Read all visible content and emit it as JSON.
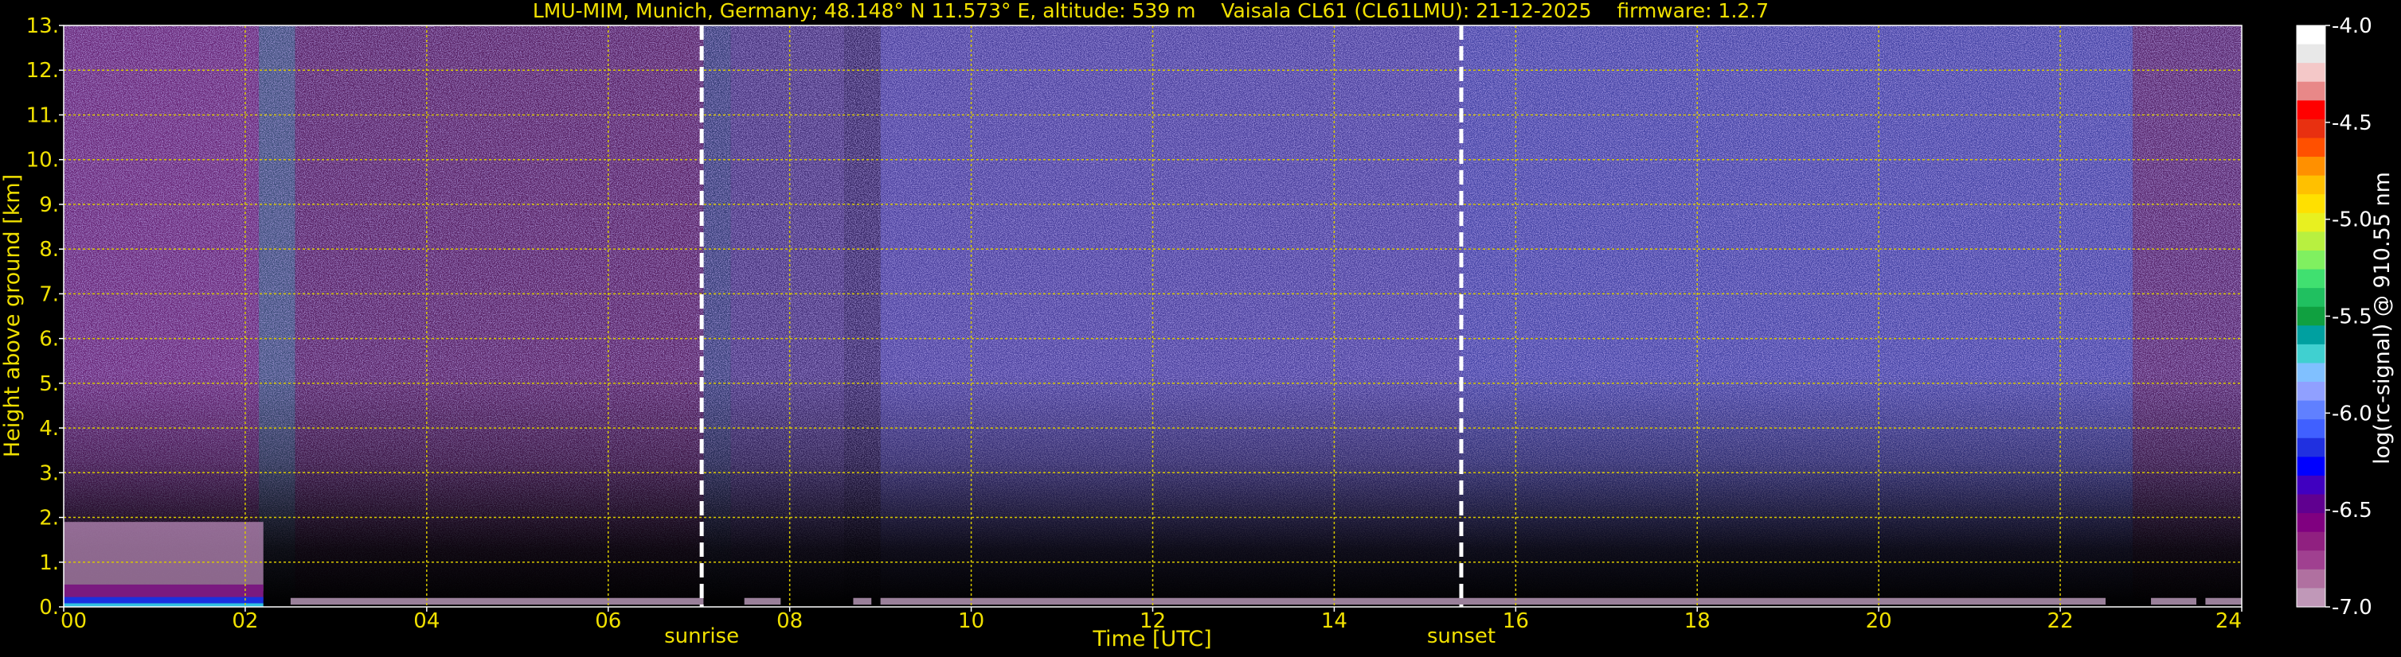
{
  "chart_data": {
    "type": "heatmap",
    "title": "LMU-MIM, Munich, Germany; 48.148° N 11.573° E, altitude: 539 m    Vaisala CL61 (CL61LMU): 21-12-2025    firmware: 1.2.7",
    "xlabel": "Time [UTC]",
    "ylabel": "Height above ground [km]",
    "xlim": [
      0,
      24
    ],
    "ylim": [
      0,
      13
    ],
    "x_ticks": [
      "00",
      "02",
      "04",
      "06",
      "08",
      "10",
      "12",
      "14",
      "16",
      "18",
      "20",
      "22",
      "24"
    ],
    "y_ticks": [
      "0.",
      "1.",
      "2.",
      "3.",
      "4.",
      "5.",
      "6.",
      "7.",
      "8.",
      "9.",
      "10.",
      "11.",
      "12.",
      "13."
    ],
    "grid": true,
    "vlines": [
      {
        "label": "sunrise",
        "x": 7.03
      },
      {
        "label": "sunset",
        "x": 15.4
      }
    ],
    "colorbar": {
      "label": "log(rc-signal) @ 910.55 nm",
      "range": [
        -7.0,
        -4.0
      ],
      "ticks": [
        "-4.0",
        "-4.5",
        "-5.0",
        "-5.5",
        "-6.0",
        "-6.5",
        "-7.0"
      ],
      "colors": [
        "#ffffff",
        "#e8e8e8",
        "#f4c8c8",
        "#e88888",
        "#ff0000",
        "#e83010",
        "#ff5000",
        "#ff9000",
        "#ffc000",
        "#ffe000",
        "#e8f020",
        "#b8f040",
        "#80f060",
        "#40e070",
        "#20c060",
        "#10a040",
        "#00a0a0",
        "#40d0d0",
        "#80c0ff",
        "#90a0ff",
        "#6080ff",
        "#4060ff",
        "#2030e0",
        "#0000ff",
        "#4000c0",
        "#600090",
        "#800080",
        "#902080",
        "#a04090",
        "#b070a0",
        "#c098b8"
      ]
    }
  }
}
